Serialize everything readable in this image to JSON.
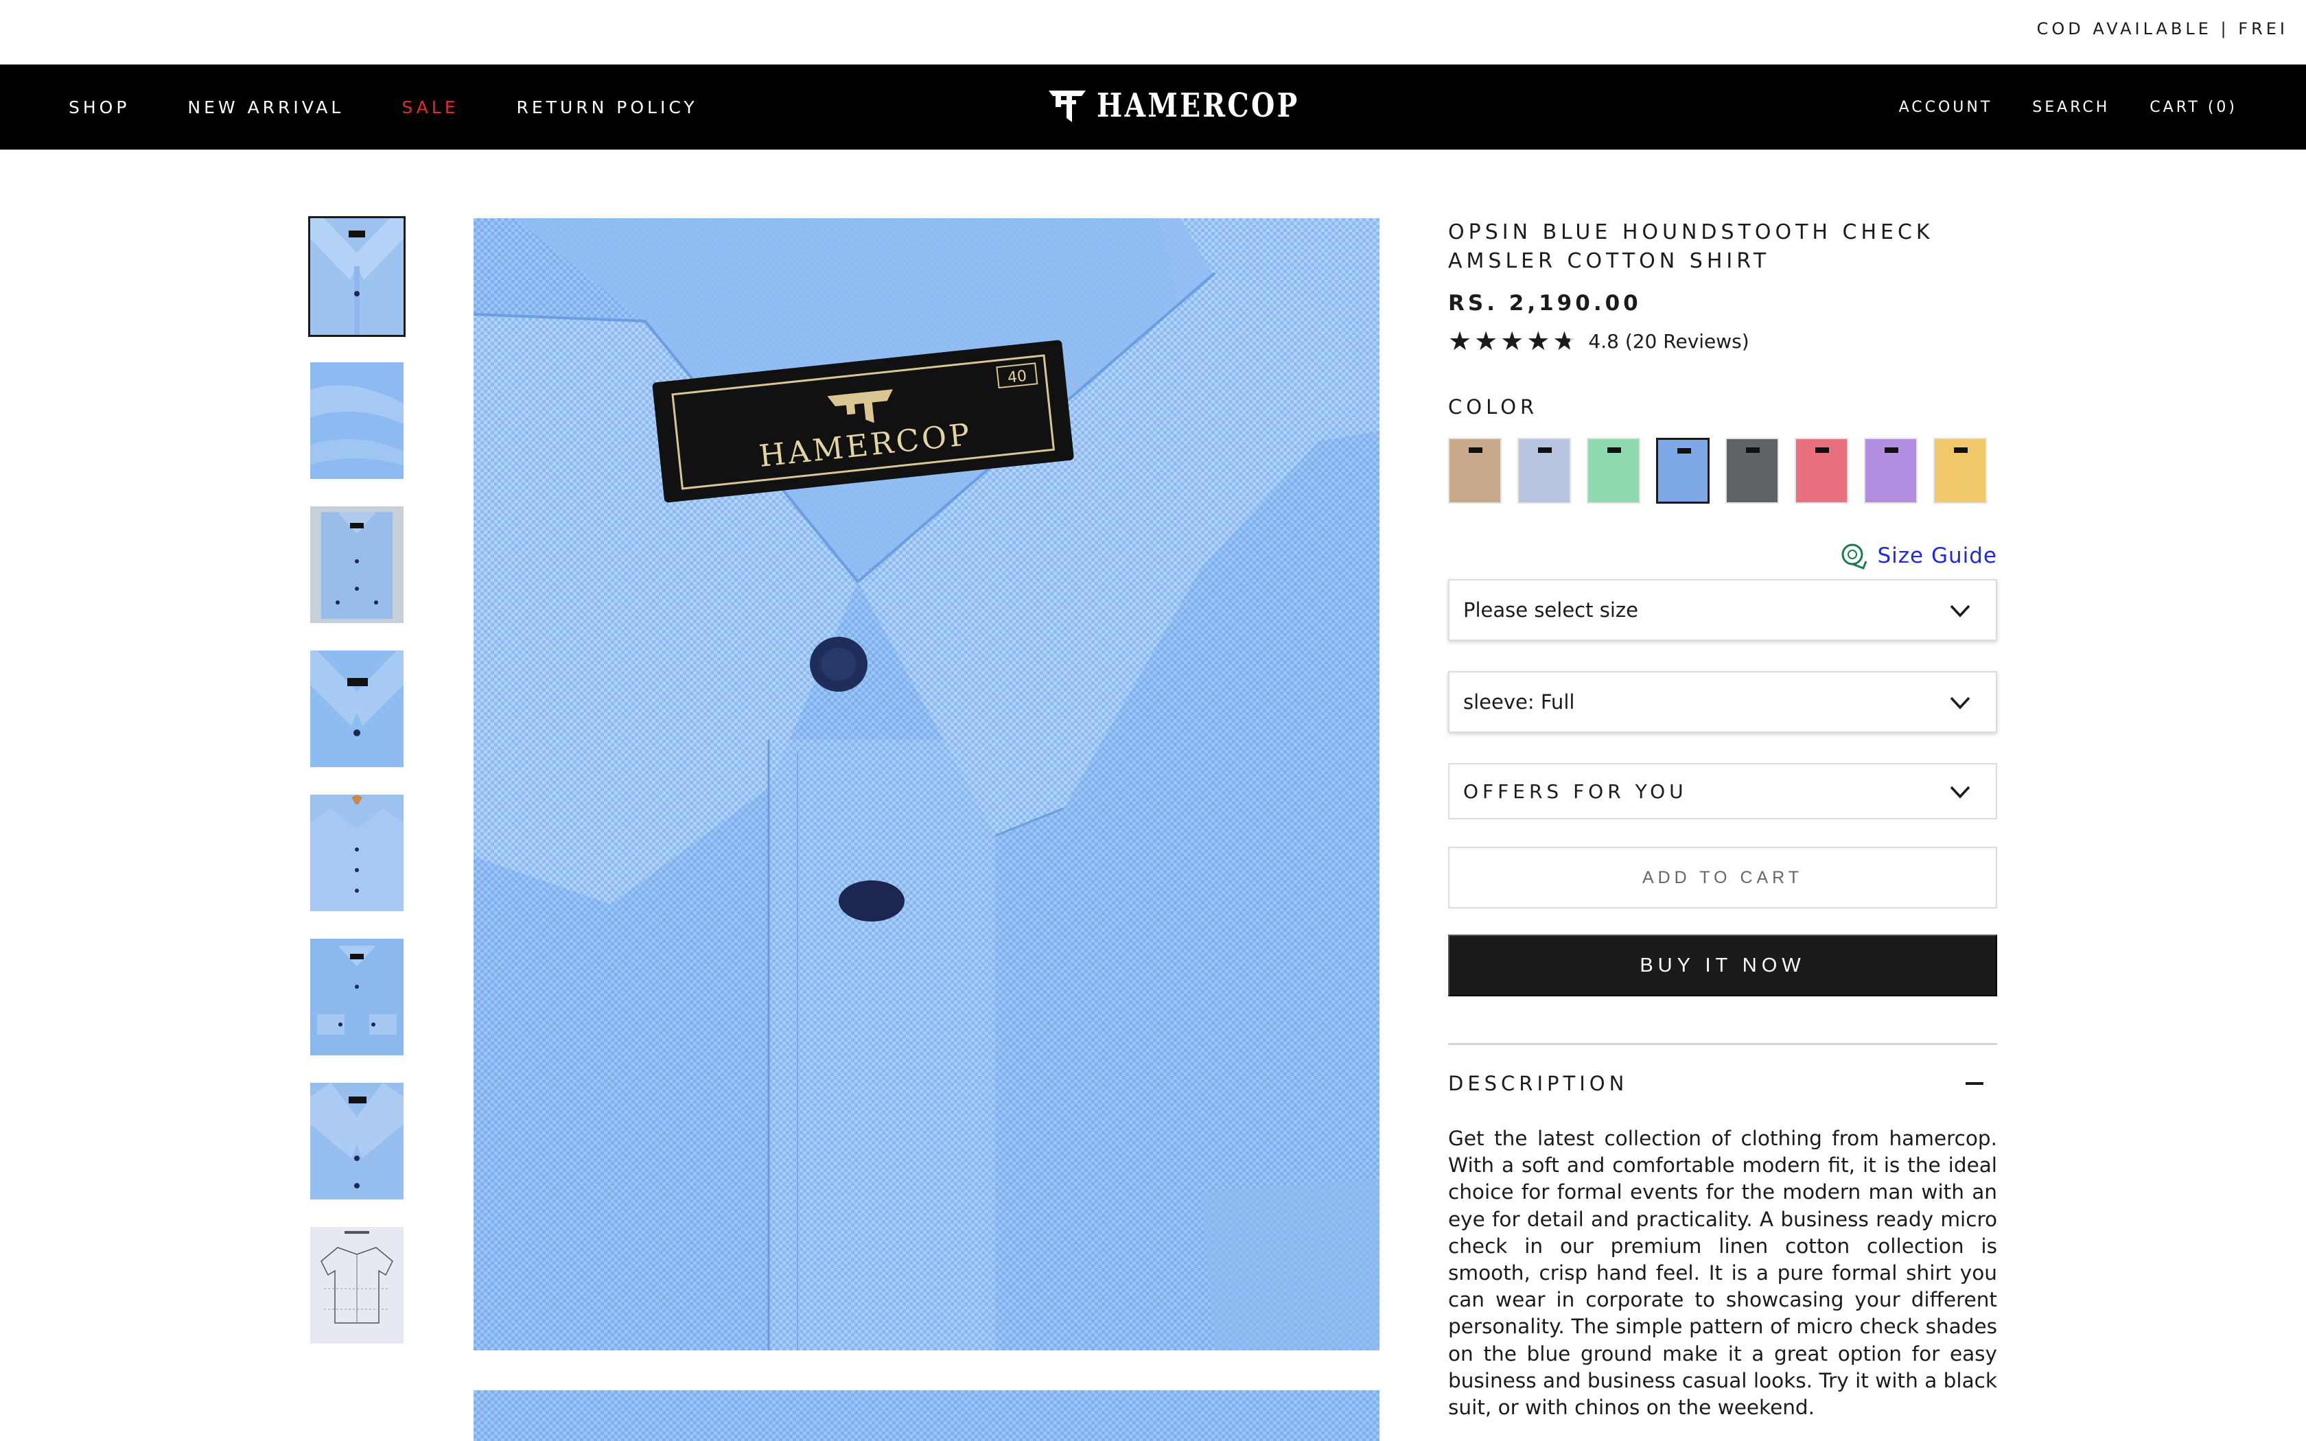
{
  "announcement": {
    "text": "COD AVAILABLE | FREI"
  },
  "nav": {
    "left": [
      {
        "label": "SHOP"
      },
      {
        "label": "NEW ARRIVAL"
      },
      {
        "label": "SALE"
      },
      {
        "label": "RETURN POLICY"
      }
    ],
    "logo_text": "HAMERCOP",
    "right": {
      "account": "ACCOUNT",
      "search": "SEARCH",
      "cart": "CART (0)"
    }
  },
  "gallery": {
    "main_tag_brand": "HAMERCOP",
    "main_tag_size": "40",
    "thumbnails": [
      {
        "icon": "shirt-collar-thumb"
      },
      {
        "icon": "fabric-thumb"
      },
      {
        "icon": "shirt-folded-thumb"
      },
      {
        "icon": "shirt-collar-closeup-thumb"
      },
      {
        "icon": "shirt-hanger-thumb"
      },
      {
        "icon": "shirt-cuffs-thumb"
      },
      {
        "icon": "shirt-front-thumb"
      },
      {
        "icon": "size-chart-thumb"
      }
    ]
  },
  "product": {
    "title": "OPSIN BLUE HOUNDSTOOTH CHECK AMSLER COTTON SHIRT",
    "price": "RS. 2,190.00",
    "rating": 4.8,
    "rating_text": "4.8 (20 Reviews)",
    "color_label": "COLOR",
    "swatches": [
      {
        "name": "beige",
        "color": "#c9a98c"
      },
      {
        "name": "light-blue-grey",
        "color": "#b7c3df"
      },
      {
        "name": "mint-green",
        "color": "#8ed9b0"
      },
      {
        "name": "blue",
        "color": "#7fa8e6",
        "selected": true
      },
      {
        "name": "grey",
        "color": "#5f6368"
      },
      {
        "name": "pink",
        "color": "#e8707f"
      },
      {
        "name": "lavender",
        "color": "#b48ee0"
      },
      {
        "name": "yellow",
        "color": "#f2c96a"
      }
    ],
    "size_guide": "Size Guide",
    "size_select": "Please select size",
    "sleeve_select": "sleeve: Full",
    "offers": "OFFERS FOR YOU",
    "add_to_cart": "ADD TO CART",
    "buy_now": "BUY IT NOW",
    "description_title": "DESCRIPTION",
    "description": "Get the latest collection of clothing from hamercop. With a soft and comfortable modern fit, it is the ideal choice for formal events for the modern man with an eye for detail and practicality. A business ready micro check in our premium linen cotton collection is smooth, crisp hand feel. It is a pure formal shirt you can wear in corporate to showcasing your different personality. The simple pattern of micro check shades on the blue ground make it a great option for easy business and business casual looks. Try it with a black suit, or with chinos on the weekend."
  }
}
